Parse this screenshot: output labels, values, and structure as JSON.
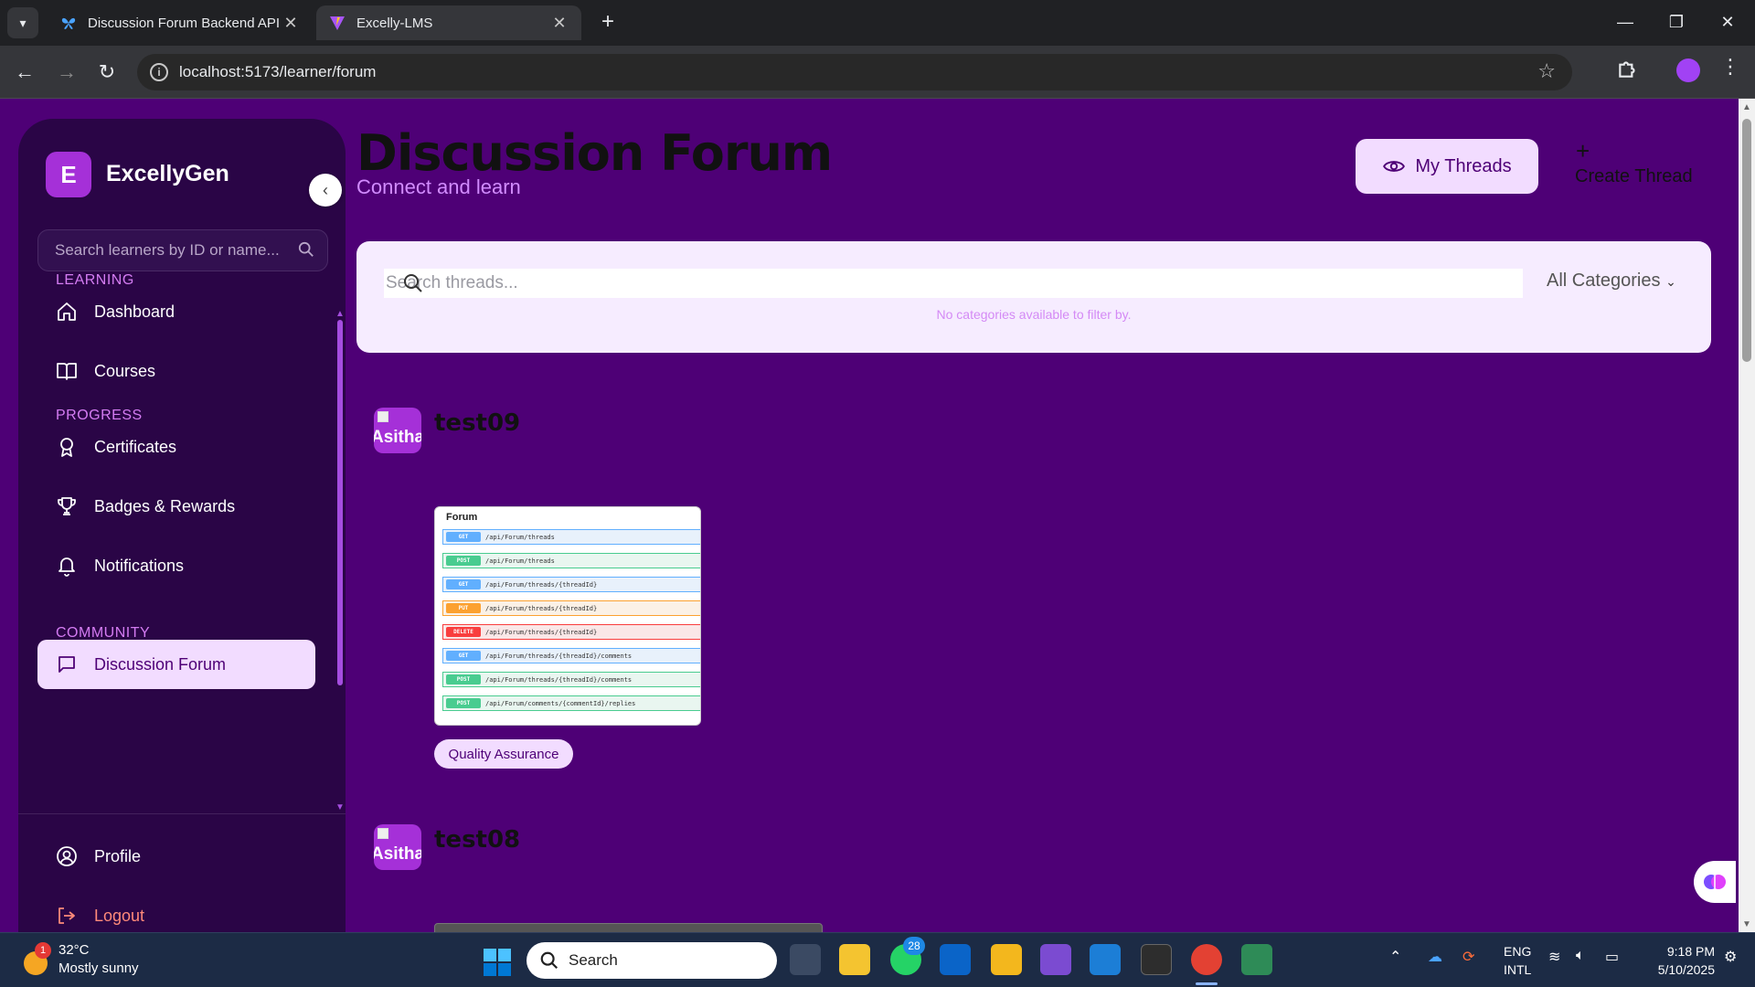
{
  "browser": {
    "tabs": [
      {
        "title": "Discussion Forum Backend API |"
      },
      {
        "title": "Excelly-LMS"
      }
    ],
    "url": "localhost:5173/learner/forum"
  },
  "sidebar": {
    "logo_letter": "E",
    "brand": "ExcellyGen",
    "search_placeholder": "Search learners by ID or name...",
    "sections": {
      "learning": "LEARNING",
      "progress": "PROGRESS",
      "community": "COMMUNITY"
    },
    "items": {
      "dashboard": "Dashboard",
      "courses": "Courses",
      "certificates": "Certificates",
      "badges": "Badges & Rewards",
      "notifications": "Notifications",
      "forum": "Discussion Forum",
      "profile": "Profile",
      "logout": "Logout"
    }
  },
  "header": {
    "title": "Discussion Forum",
    "subtitle": "Connect and learn",
    "my_threads": "My Threads",
    "create_thread": "Create Thread"
  },
  "filters": {
    "search_placeholder": "Search threads...",
    "category": "All Categories",
    "no_categories": "No categories available to filter by."
  },
  "threads": [
    {
      "avatar_text": "Asitha",
      "user": "test09",
      "tag": "Quality Assurance",
      "image": {
        "title": "Forum",
        "endpoints": [
          {
            "method": "GET",
            "path": "/api/Forum/threads"
          },
          {
            "method": "POST",
            "path": "/api/Forum/threads"
          },
          {
            "method": "GET",
            "path": "/api/Forum/threads/{threadId}"
          },
          {
            "method": "PUT",
            "path": "/api/Forum/threads/{threadId}"
          },
          {
            "method": "DELETE",
            "path": "/api/Forum/threads/{threadId}"
          },
          {
            "method": "GET",
            "path": "/api/Forum/threads/{threadId}/comments"
          },
          {
            "method": "POST",
            "path": "/api/Forum/threads/{threadId}/comments"
          },
          {
            "method": "POST",
            "path": "/api/Forum/comments/{commentId}/replies"
          }
        ]
      }
    },
    {
      "avatar_text": "Asitha",
      "user": "test08"
    }
  ],
  "taskbar": {
    "temperature": "32°C",
    "weather": "Mostly sunny",
    "weather_badge": "1",
    "search": "Search",
    "whatsapp_badge": "28",
    "lang_top": "ENG",
    "lang_bottom": "INTL",
    "time": "9:18 PM",
    "date": "5/10/2025"
  },
  "colors": {
    "page_bg": "#4e0076",
    "sidebar_bg": "#2a0546",
    "accent_light": "#f2dcff",
    "section_label": "#d47cf2",
    "logout": "#ff8a7a"
  }
}
